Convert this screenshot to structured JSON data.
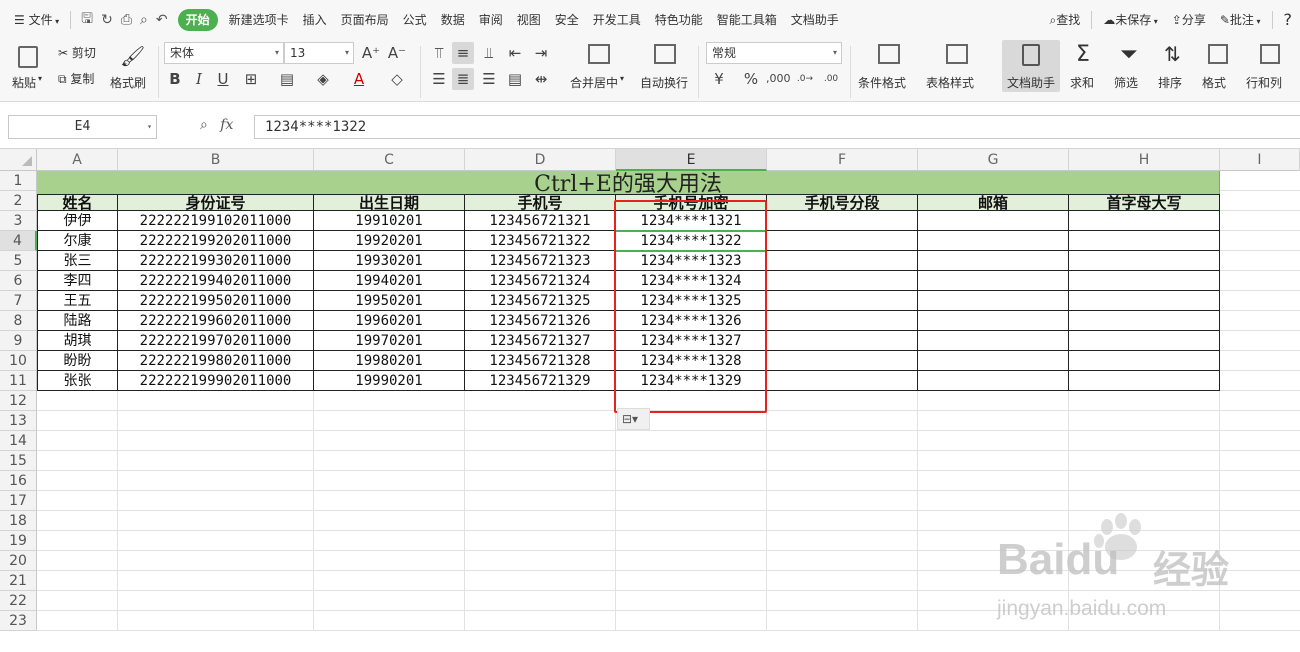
{
  "menubar": {
    "file_label": "文件",
    "tabs": [
      "开始",
      "新建选项卡",
      "插入",
      "页面布局",
      "公式",
      "数据",
      "审阅",
      "视图",
      "安全",
      "开发工具",
      "特色功能",
      "智能工具箱",
      "文档助手"
    ],
    "active_tab": "开始",
    "search_label": "查找",
    "unsaved_label": "未保存",
    "share_label": "分享",
    "comment_label": "批注",
    "help_label": "?"
  },
  "ribbon": {
    "paste": "粘贴",
    "cut": "剪切",
    "copy": "复制",
    "format_painter": "格式刷",
    "font_name": "宋体",
    "font_size": "13",
    "grow_font": "A⁺",
    "shrink_font": "A⁻",
    "bold": "B",
    "italic": "I",
    "underline": "U",
    "merge_center": "合并居中",
    "wrap_text": "自动换行",
    "number_format": "常规",
    "percent": "%",
    "conditional_format": "条件格式",
    "table_style": "表格样式",
    "doc_helper": "文档助手",
    "sum": "求和",
    "filter": "筛选",
    "sort": "排序",
    "format": "格式",
    "rows_cols": "行和列"
  },
  "formula_bar": {
    "name_box": "E4",
    "fx_label": "fx",
    "content": "1234****1322"
  },
  "sheet": {
    "columns": [
      "A",
      "B",
      "C",
      "D",
      "E",
      "F",
      "G",
      "H",
      "I"
    ],
    "rows": [
      "1",
      "2",
      "3",
      "4",
      "5",
      "6",
      "7",
      "8",
      "9",
      "10",
      "11",
      "12",
      "13",
      "14",
      "15",
      "16",
      "17",
      "18",
      "19",
      "20",
      "21",
      "22",
      "23"
    ],
    "title": "Ctrl+E的强大用法",
    "headers": [
      "姓名",
      "身份证号",
      "出生日期",
      "手机号",
      "手机号加密",
      "手机号分段",
      "邮箱",
      "首字母大写"
    ],
    "data": [
      [
        "伊伊",
        "222222199102011000",
        "19910201",
        "123456721321",
        "1234****1321",
        "",
        "",
        ""
      ],
      [
        "尔康",
        "222222199202011000",
        "19920201",
        "123456721322",
        "1234****1322",
        "",
        "",
        ""
      ],
      [
        "张三",
        "222222199302011000",
        "19930201",
        "123456721323",
        "1234****1323",
        "",
        "",
        ""
      ],
      [
        "李四",
        "222222199402011000",
        "19940201",
        "123456721324",
        "1234****1324",
        "",
        "",
        ""
      ],
      [
        "王五",
        "222222199502011000",
        "19950201",
        "123456721325",
        "1234****1325",
        "",
        "",
        ""
      ],
      [
        "陆路",
        "222222199602011000",
        "19960201",
        "123456721326",
        "1234****1326",
        "",
        "",
        ""
      ],
      [
        "胡琪",
        "222222199702011000",
        "19970201",
        "123456721327",
        "1234****1327",
        "",
        "",
        ""
      ],
      [
        "盼盼",
        "222222199802011000",
        "19980201",
        "123456721328",
        "1234****1328",
        "",
        "",
        ""
      ],
      [
        "张张",
        "222222199902011000",
        "19990201",
        "123456721329",
        "1234****1329",
        "",
        "",
        ""
      ]
    ],
    "selected_column": "E",
    "selected_row": "4"
  },
  "watermark": {
    "brand": "Baidu",
    "suffix": "经验",
    "url": "jingyan.baidu.com"
  },
  "colors": {
    "accent": "#4caf50",
    "title_fill": "#a9d18e",
    "header_fill": "#e2efda",
    "highlight_box": "#e8211d"
  }
}
